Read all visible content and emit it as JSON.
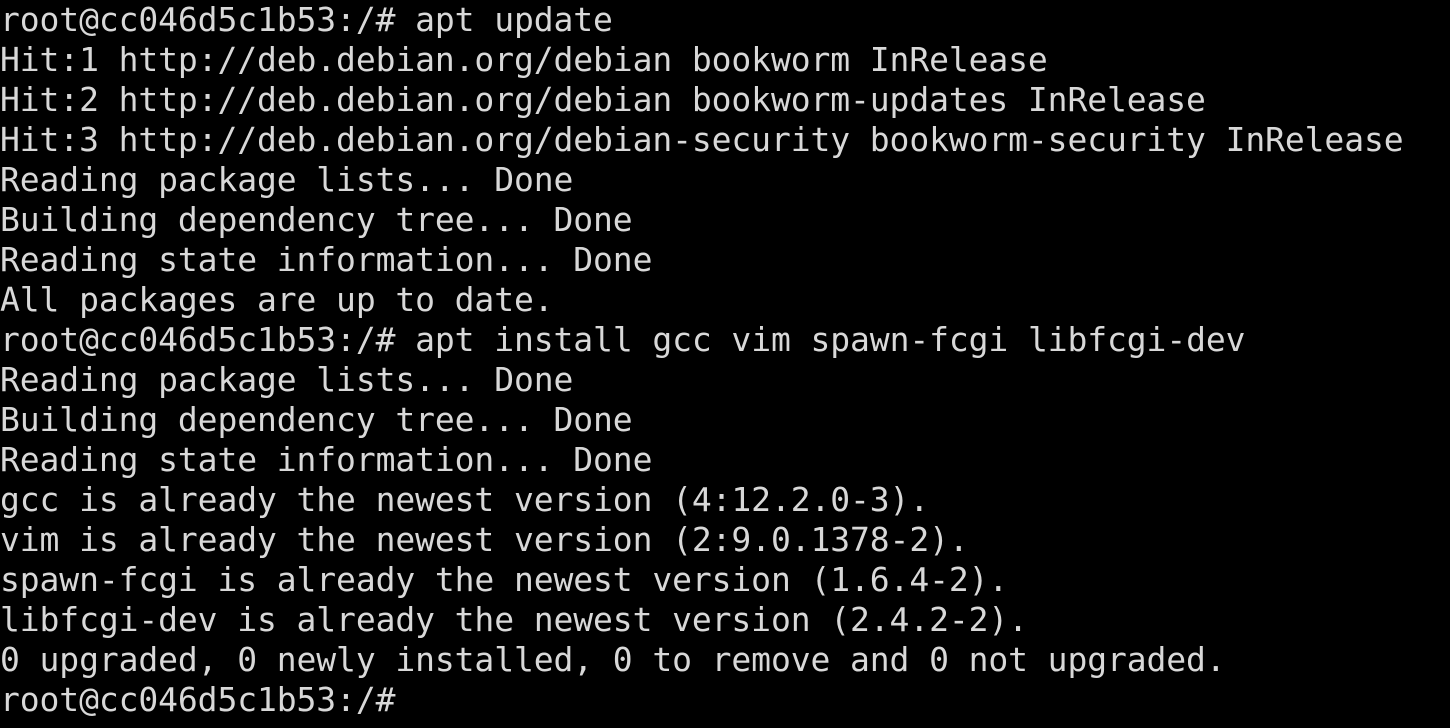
{
  "terminal": {
    "lines": [
      {
        "kind": "prompt",
        "prompt": "root@cc046d5c1b53:/#",
        "command": "apt update"
      },
      {
        "kind": "output",
        "text": "Hit:1 http://deb.debian.org/debian bookworm InRelease"
      },
      {
        "kind": "output",
        "text": "Hit:2 http://deb.debian.org/debian bookworm-updates InRelease"
      },
      {
        "kind": "output",
        "text": "Hit:3 http://deb.debian.org/debian-security bookworm-security InRelease"
      },
      {
        "kind": "output",
        "text": "Reading package lists... Done"
      },
      {
        "kind": "output",
        "text": "Building dependency tree... Done"
      },
      {
        "kind": "output",
        "text": "Reading state information... Done"
      },
      {
        "kind": "output",
        "text": "All packages are up to date."
      },
      {
        "kind": "prompt",
        "prompt": "root@cc046d5c1b53:/#",
        "command": "apt install gcc vim spawn-fcgi libfcgi-dev"
      },
      {
        "kind": "output",
        "text": "Reading package lists... Done"
      },
      {
        "kind": "output",
        "text": "Building dependency tree... Done"
      },
      {
        "kind": "output",
        "text": "Reading state information... Done"
      },
      {
        "kind": "output",
        "text": "gcc is already the newest version (4:12.2.0-3)."
      },
      {
        "kind": "output",
        "text": "vim is already the newest version (2:9.0.1378-2)."
      },
      {
        "kind": "output",
        "text": "spawn-fcgi is already the newest version (1.6.4-2)."
      },
      {
        "kind": "output",
        "text": "libfcgi-dev is already the newest version (2.4.2-2)."
      },
      {
        "kind": "output",
        "text": "0 upgraded, 0 newly installed, 0 to remove and 0 not upgraded."
      },
      {
        "kind": "prompt",
        "prompt": "root@cc046d5c1b53:/#",
        "command": ""
      }
    ],
    "colors": {
      "background": "#000000",
      "foreground": "#d8d8d8"
    }
  }
}
